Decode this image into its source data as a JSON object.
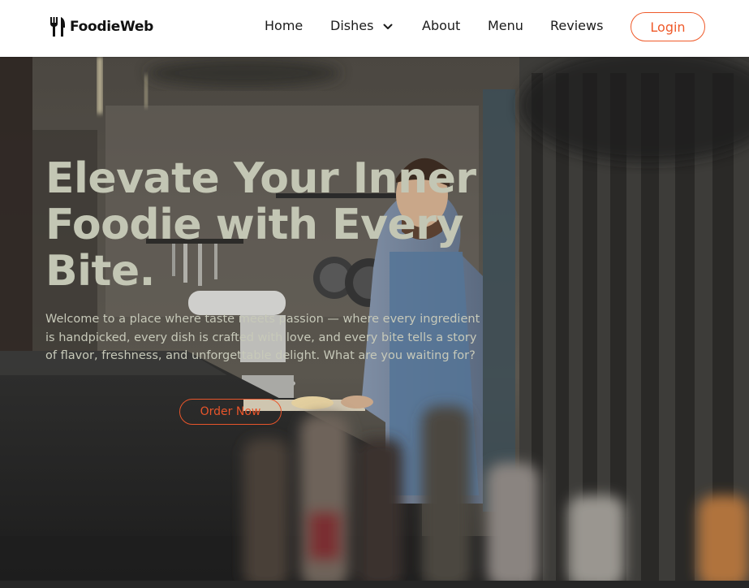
{
  "brand": {
    "name": "FoodieWeb",
    "icon": "fork-knife-icon"
  },
  "nav": {
    "items": [
      "Home",
      "Dishes",
      "About",
      "Menu",
      "Reviews"
    ],
    "dropdown_icon": "chevron-down-icon",
    "login_label": "Login"
  },
  "hero": {
    "title_lines": [
      "Elevate Your Inner",
      "Foodie with Every",
      "Bite."
    ],
    "description": "Welcome to a place where taste meets passion — where every ingredient is handpicked, every dish is crafted with love, and every bite tells a story of flavor, freshness, and unforgettable delight. What are you waiting for?",
    "cta_label": "Order Now"
  },
  "colors": {
    "accent": "#ef5a2a",
    "nav_background": "#ffffff",
    "hero_title": "#c3c6b4",
    "hero_text": "#c7c9b9"
  }
}
